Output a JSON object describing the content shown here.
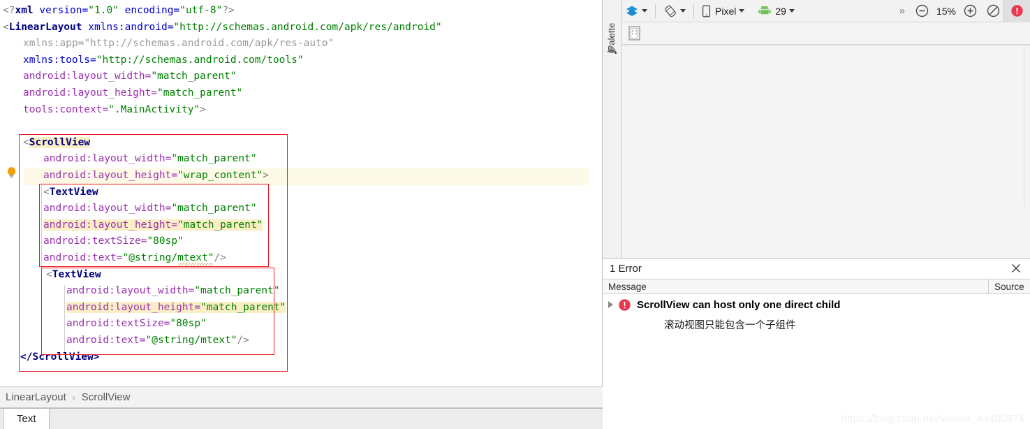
{
  "editor": {
    "lines": [
      {
        "indent": 0,
        "tokens": [
          {
            "t": "<?",
            "c": "punc"
          },
          {
            "t": "xml",
            "c": "decl"
          },
          {
            "t": " version=",
            "c": "eq"
          },
          {
            "t": "\"1.0\"",
            "c": "val"
          },
          {
            "t": " encoding=",
            "c": "eq"
          },
          {
            "t": "\"utf-8\"",
            "c": "val"
          },
          {
            "t": "?>",
            "c": "punc"
          }
        ]
      },
      {
        "indent": 0,
        "tokens": [
          {
            "t": "<",
            "c": "punc"
          },
          {
            "t": "LinearLayout",
            "c": "tag"
          },
          {
            "t": " xmlns:android=",
            "c": "eq"
          },
          {
            "t": "\"http://schemas.android.com/apk/res/android\"",
            "c": "val"
          }
        ]
      },
      {
        "indent": 1,
        "tokens": [
          {
            "t": "xmlns:app=",
            "c": "attr-dim"
          },
          {
            "t": "\"http://schemas.android.com/apk/res-auto\"",
            "c": "val-dim"
          }
        ]
      },
      {
        "indent": 1,
        "tokens": [
          {
            "t": "xmlns:tools=",
            "c": "eq"
          },
          {
            "t": "\"http://schemas.android.com/tools\"",
            "c": "val"
          }
        ]
      },
      {
        "indent": 1,
        "tokens": [
          {
            "t": "android:layout_width=",
            "c": "attr"
          },
          {
            "t": "\"match_parent\"",
            "c": "val"
          }
        ]
      },
      {
        "indent": 1,
        "tokens": [
          {
            "t": "android:layout_height=",
            "c": "attr"
          },
          {
            "t": "\"match_parent\"",
            "c": "val"
          }
        ]
      },
      {
        "indent": 1,
        "tokens": [
          {
            "t": "tools:context=",
            "c": "attr"
          },
          {
            "t": "\".MainActivity\"",
            "c": "val"
          },
          {
            "t": ">",
            "c": "punc"
          }
        ]
      }
    ],
    "block": {
      "scrollview_open_punc": "<",
      "scrollview_open_tag": "ScrollView",
      "scrollview_attr1_name": "android:layout_width=",
      "scrollview_attr1_val": "\"match_parent\"",
      "scrollview_attr2_name": "android:layout_height=",
      "scrollview_attr2_val": "\"wrap_content\"",
      "scrollview_attr2_close": ">",
      "scrollview_close": "</ScrollView>",
      "textview_open_punc": "<",
      "textview_open_tag": "TextView",
      "tv_width_name": "android:layout_width=",
      "tv_width_val": "\"match_parent\"",
      "tv_height_name": "android:layout_height=",
      "tv_height_val": "\"match_parent\"",
      "tv_size_name": "android:textSize=",
      "tv_size_val": "\"80sp\"",
      "tv_text_name": "android:text=",
      "tv_text_val": "\"@string/mtext\"",
      "tv_selfclose": "/>"
    }
  },
  "breadcrumb": {
    "items": [
      "LinearLayout",
      "ScrollView"
    ],
    "separator": "›"
  },
  "tabs": [
    {
      "label": "Text",
      "active": true
    }
  ],
  "palette": {
    "label": "Palette",
    "icon": "palette-stack-icon"
  },
  "design_toolbar": {
    "layers_icon": "layers-icon",
    "orientation_icon": "orientation-rotate-icon",
    "device_icon": "phone-icon",
    "device_label": "Pixel",
    "api_icon": "android-robot-icon",
    "api_label": "29",
    "overflow_label": "»",
    "zoom_out_icon": "zoom-out-icon",
    "zoom_level": "15%",
    "zoom_in_icon": "zoom-in-icon",
    "zoom_fit_icon": "zoom-reset-icon",
    "error_badge_icon": "error-badge-icon"
  },
  "design_subbar": {
    "preview_thumb_icon": "device-preview-thumbnail-icon"
  },
  "error_panel": {
    "header": "1 Error",
    "close_icon": "close-icon",
    "columns": {
      "message": "Message",
      "source": "Source"
    },
    "rows": [
      {
        "expander_icon": "chevron-right-icon",
        "severity_icon": "error-icon",
        "title": "ScrollView can host only one direct child",
        "detail": "滚动视图只能包含一个子组件"
      }
    ]
  },
  "gutter": {
    "hint_icon": "lightbulb-icon"
  },
  "watermark": {
    "text": "https://blog.csdn.net/weixin_44480874"
  },
  "colors": {
    "tag": "#000080",
    "attribute": "#9b30b0",
    "value": "#008000",
    "annotation_box": "#ee1c24",
    "highlight": "#faeec4",
    "error_red": "#e8384f",
    "accent_blue": "#1e88d2",
    "marker_yellow": "#e8c020"
  }
}
